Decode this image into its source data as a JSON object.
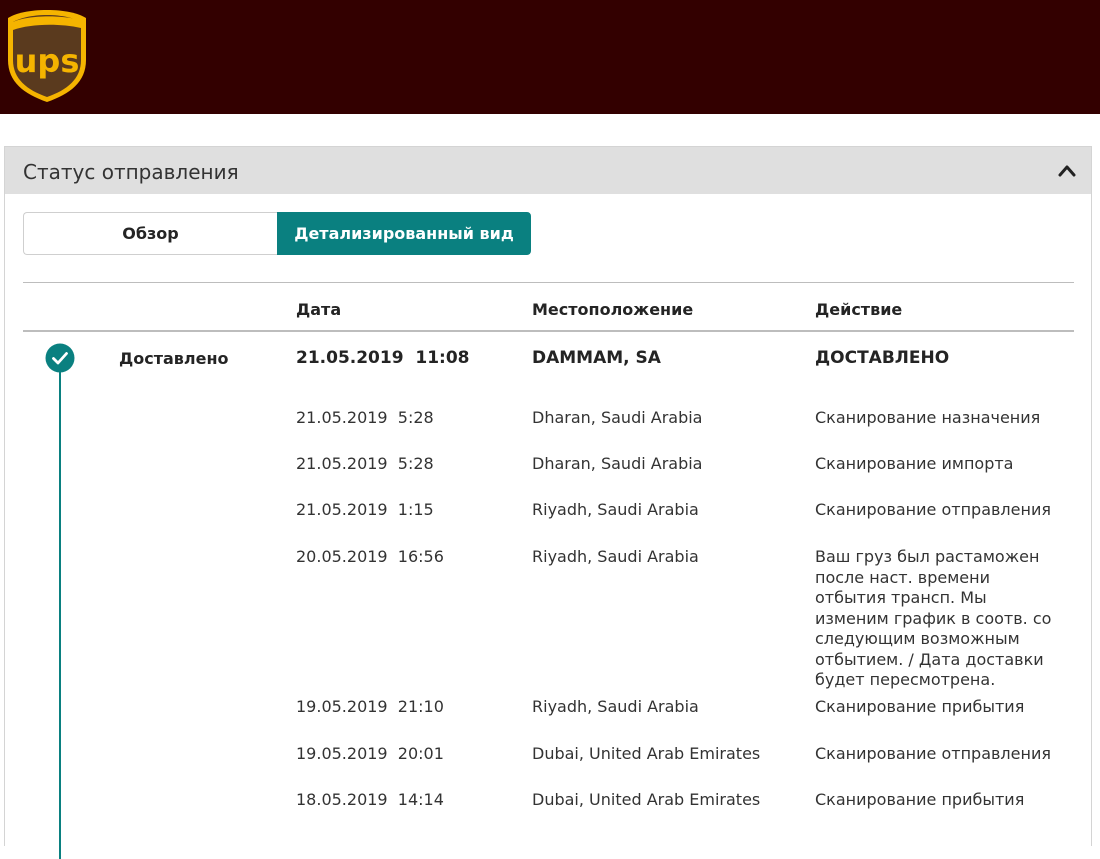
{
  "header": {
    "logo_text": "ups",
    "brand_color": "#330000",
    "logo_gold": "#f5b400",
    "logo_brown": "#5a3a1e"
  },
  "panel": {
    "title": "Статус отправления",
    "collapse_icon": "chevron-up-icon"
  },
  "tabs": [
    {
      "label": "Обзор",
      "active": false
    },
    {
      "label": "Детализированный вид",
      "active": true
    }
  ],
  "accent_color": "#0a8080",
  "columns": {
    "date": "Дата",
    "location": "Местоположение",
    "action": "Действие"
  },
  "status": {
    "label": "Доставлено",
    "icon": "check-circle-icon"
  },
  "events": [
    {
      "date": "21.05.2019  11:08",
      "location": "DAMMAM, SA",
      "action": "ДОСТАВЛЕНО"
    },
    {
      "date": "21.05.2019  5:28",
      "location": "Dharan, Saudi Arabia",
      "action": "Сканирование назначения"
    },
    {
      "date": "21.05.2019  5:28",
      "location": "Dharan, Saudi Arabia",
      "action": "Сканирование импорта"
    },
    {
      "date": "21.05.2019  1:15",
      "location": "Riyadh, Saudi Arabia",
      "action": "Сканирование отправления"
    },
    {
      "date": "20.05.2019  16:56",
      "location": "Riyadh, Saudi Arabia",
      "action": "Ваш груз был растаможен после наст. времени отбытия трансп. Мы изменим график в соотв. со следующим возможным отбытием. / Дата доставки будет пересмотрена."
    },
    {
      "date": "19.05.2019  21:10",
      "location": "Riyadh, Saudi Arabia",
      "action": "Сканирование прибытия"
    },
    {
      "date": "19.05.2019  20:01",
      "location": "Dubai, United Arab Emirates",
      "action": "Сканирование отправления"
    },
    {
      "date": "18.05.2019  14:14",
      "location": "Dubai, United Arab Emirates",
      "action": "Сканирование прибытия"
    }
  ]
}
